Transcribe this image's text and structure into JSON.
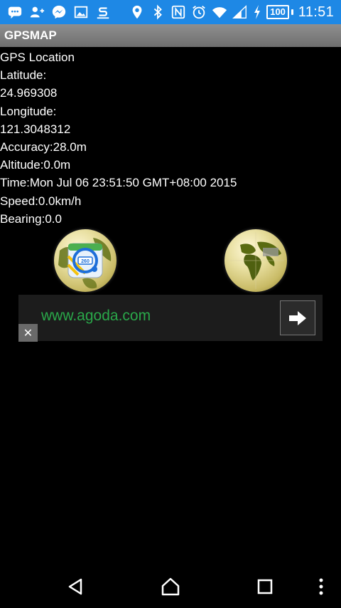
{
  "status_bar": {
    "battery": "100",
    "time": "11:51",
    "left_icons": [
      "chat-icon",
      "add-contact-icon",
      "messenger-icon",
      "gallery-icon",
      "s-app-icon"
    ],
    "right_icons": [
      "location-pin-icon",
      "bluetooth-icon",
      "nfc-icon",
      "alarm-icon",
      "wifi-icon",
      "signal-icon",
      "charging-icon"
    ]
  },
  "app": {
    "title": "GPSMAP"
  },
  "gps": {
    "heading": "GPS Location",
    "latitude_label": "Latitude:",
    "latitude_value": "24.969308",
    "longitude_label": "Longitude:",
    "longitude_value": "121.3048312",
    "accuracy": "Accuracy:28.0m",
    "altitude": "Altitude:0.0m",
    "time": "Time:Mon Jul 06 23:51:50 GMT+08:00 2015",
    "speed": "Speed:0.0km/h",
    "bearing": "Bearing:0.0"
  },
  "buttons": {
    "maps_globe": "maps-globe-icon",
    "world_globe": "world-globe-icon"
  },
  "ad": {
    "url": "www.agoda.com",
    "close": "✕"
  },
  "colors": {
    "status_bar": "#1e88e5",
    "title_bar": "#7d7d7d",
    "ad_link": "#2aa84a"
  }
}
